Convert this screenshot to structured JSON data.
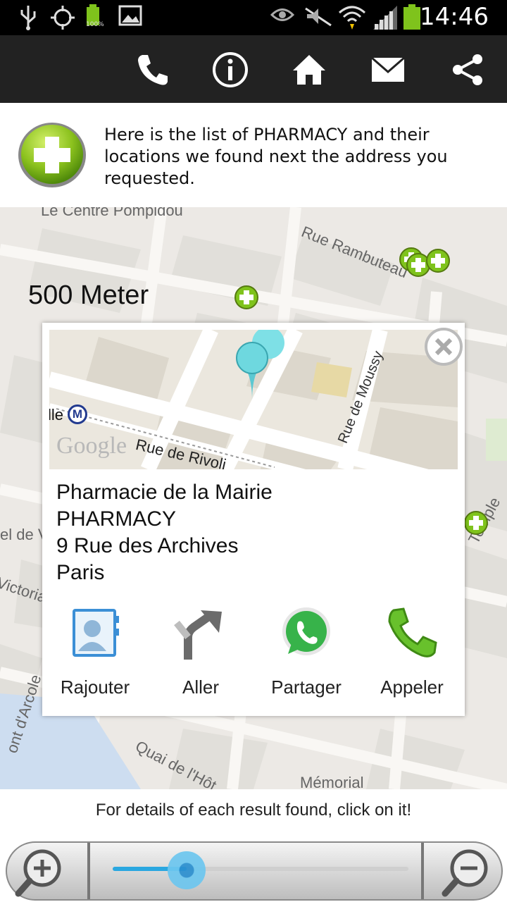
{
  "status_bar": {
    "time": "14:46",
    "battery_label": "100%",
    "icons": [
      "usb-icon",
      "gps-icon",
      "battery-icon",
      "image-icon",
      "eye-icon",
      "mute-icon",
      "wifi-icon",
      "signal-icon",
      "battery-status-icon"
    ]
  },
  "action_bar": {
    "buttons": [
      "phone-icon",
      "info-icon",
      "home-icon",
      "mail-icon",
      "share-icon"
    ]
  },
  "header": {
    "message": "Here is the list of PHARMACY and their locations we found next the address you requested."
  },
  "map": {
    "scale_label": "500 Meter",
    "labels": [
      "Le Centre Pompidou",
      "Rue Rambuteau",
      "el de V",
      "Victoria",
      "ont d'Arcole",
      "Quai de l'Hôt",
      "Mémorial",
      "Temple"
    ],
    "marker_icon": "pharmacy-marker-icon"
  },
  "popup": {
    "mini_map": {
      "street_1": "Rue de Moussy",
      "street_2": "Rue de Rivoli",
      "metro_label": "lle",
      "metro_symbol": "M",
      "watermark": "Google"
    },
    "name": "Pharmacie de la Mairie",
    "category": "PHARMACY",
    "address": "9 Rue des Archives",
    "city": "Paris",
    "actions": [
      {
        "label": "Rajouter",
        "icon": "contacts-icon"
      },
      {
        "label": "Aller",
        "icon": "directions-icon"
      },
      {
        "label": "Partager",
        "icon": "whatsapp-icon"
      },
      {
        "label": "Appeler",
        "icon": "call-icon"
      }
    ]
  },
  "footer": {
    "hint": "For details of each result found, click on it!",
    "zoom_level": 0.25
  },
  "colors": {
    "status_bar": "#000000",
    "action_bar": "#222222",
    "accent": "#2aa7e0",
    "pharmacy_green": "#7fc31c"
  }
}
